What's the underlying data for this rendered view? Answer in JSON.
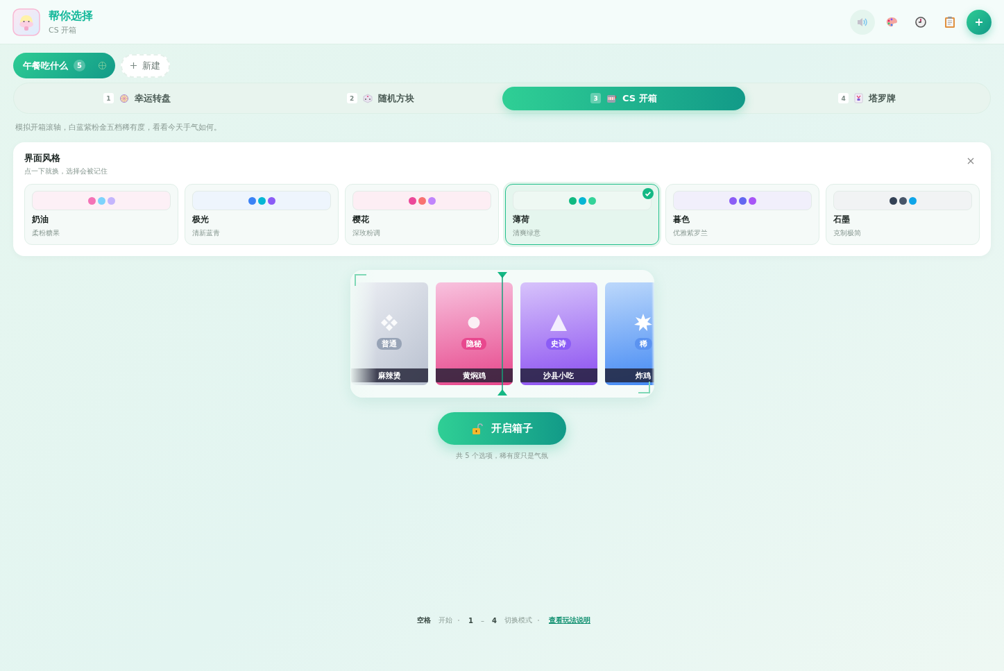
{
  "app": {
    "title": "帮你选择",
    "subtitle": "CS 开箱"
  },
  "header_actions": [
    {
      "kind": "sound",
      "selected": true
    },
    {
      "kind": "palette",
      "selected": false
    },
    {
      "kind": "history",
      "selected": false
    },
    {
      "kind": "notes",
      "selected": false
    }
  ],
  "lists": [
    {
      "label": "午餐吃什么",
      "count": "5",
      "selected": true
    }
  ],
  "new_list": "新建",
  "modes": [
    {
      "index": "1",
      "kind": "wheel",
      "label": "幸运转盘",
      "selected": false
    },
    {
      "index": "2",
      "kind": "dice",
      "label": "随机方块",
      "selected": false
    },
    {
      "index": "3",
      "kind": "slot",
      "label": "CS 开箱",
      "selected": true
    },
    {
      "index": "4",
      "kind": "tarot",
      "label": "塔罗牌",
      "selected": false
    }
  ],
  "description": "模拟开箱滚轴，白蓝紫粉金五档稀有度，看看今天手气如何。",
  "theme_panel": {
    "title": "界面风格",
    "subtitle": "点一下就换，选择会被记住",
    "themes": [
      {
        "name": "奶油",
        "note": "柔粉糖果",
        "selected": false,
        "color": "#fdf0f6",
        "dots": [
          {
            "color": "#f472b6"
          },
          {
            "color": "#7dd3fc"
          },
          {
            "color": "#c4b5fd"
          }
        ]
      },
      {
        "name": "极光",
        "note": "清新蓝青",
        "selected": false,
        "color": "#eef5fd",
        "dots": [
          {
            "color": "#3b82f6"
          },
          {
            "color": "#06b6d4"
          },
          {
            "color": "#8b5cf6"
          }
        ]
      },
      {
        "name": "樱花",
        "note": "深玫粉调",
        "selected": false,
        "color": "#fdeef4",
        "dots": [
          {
            "color": "#ec4899"
          },
          {
            "color": "#f87171"
          },
          {
            "color": "#c084fc"
          }
        ]
      },
      {
        "name": "薄荷",
        "note": "清爽绿意",
        "selected": true,
        "color": "#eef8f3",
        "dots": [
          {
            "color": "#10b981"
          },
          {
            "color": "#06b6d4"
          },
          {
            "color": "#34d399"
          }
        ]
      },
      {
        "name": "暮色",
        "note": "优雅紫罗兰",
        "selected": false,
        "color": "#f1effb",
        "dots": [
          {
            "color": "#8b5cf6"
          },
          {
            "color": "#6366f1"
          },
          {
            "color": "#a855f7"
          }
        ]
      },
      {
        "name": "石墨",
        "note": "克制极简",
        "selected": false,
        "color": "#f1f3f4",
        "dots": [
          {
            "color": "#334155"
          },
          {
            "color": "#475569"
          },
          {
            "color": "#0ea5e9"
          }
        ]
      }
    ]
  },
  "reel": [
    {
      "kind": "common",
      "rarity": "普通",
      "name": "麻辣烫"
    },
    {
      "kind": "covert",
      "rarity": "隐秘",
      "name": "黄焖鸡"
    },
    {
      "kind": "epic",
      "rarity": "史诗",
      "name": "沙县小吃"
    },
    {
      "kind": "rare",
      "rarity": "稀",
      "name": "炸鸡"
    }
  ],
  "open_button": "开启箱子",
  "hint": "共 5 个选项，稀有度只是气氛",
  "footer": [
    {
      "kind": "key",
      "text": "空格"
    },
    {
      "kind": "label",
      "text": "开始"
    },
    {
      "kind": "sep"
    },
    {
      "kind": "key",
      "text": "1"
    },
    {
      "kind": "label",
      "text": "–"
    },
    {
      "kind": "key",
      "text": "4"
    },
    {
      "kind": "label",
      "text": "切换模式"
    },
    {
      "kind": "sep"
    },
    {
      "kind": "link",
      "text": "查看玩法说明"
    }
  ]
}
